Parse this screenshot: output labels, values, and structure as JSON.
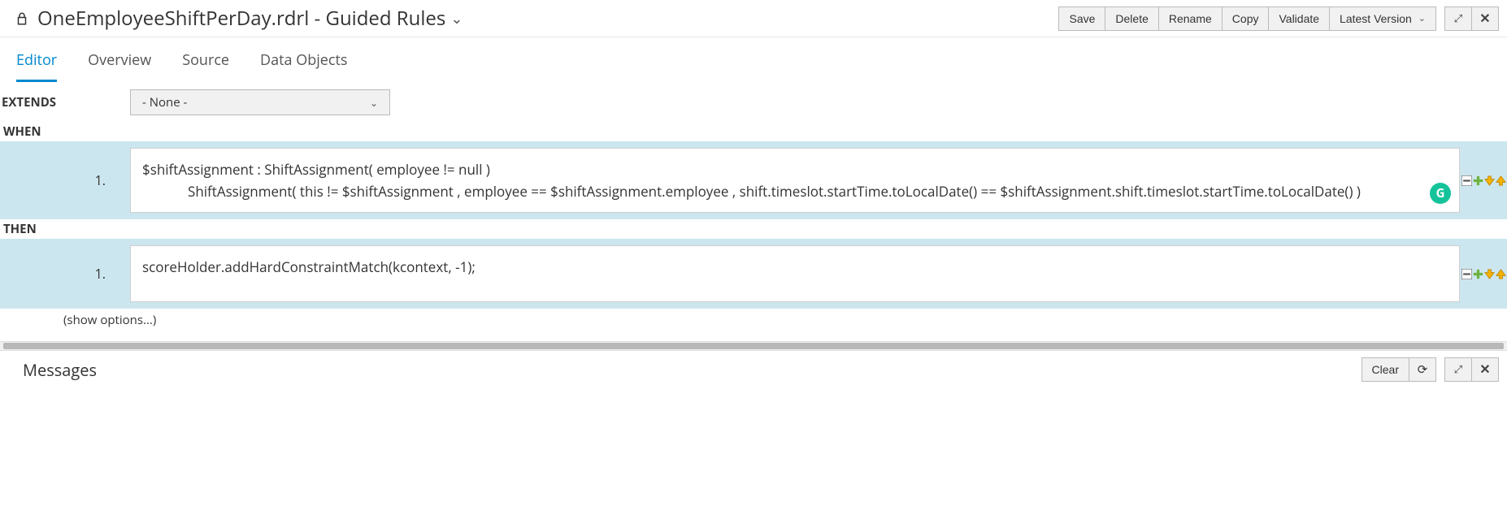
{
  "header": {
    "title": "OneEmployeeShiftPerDay.rdrl - Guided Rules"
  },
  "toolbar": {
    "save": "Save",
    "delete": "Delete",
    "rename": "Rename",
    "copy": "Copy",
    "validate": "Validate",
    "version": "Latest Version"
  },
  "tabs": {
    "editor": "Editor",
    "overview": "Overview",
    "source": "Source",
    "dataObjects": "Data Objects"
  },
  "extends": {
    "label": "EXTENDS",
    "value": "- None -"
  },
  "when": {
    "label": "WHEN",
    "items": [
      {
        "num": "1.",
        "line1": "$shiftAssignment : ShiftAssignment( employee != null )",
        "line2": "ShiftAssignment( this != $shiftAssignment , employee == $shiftAssignment.employee , shift.timeslot.startTime.toLocalDate() == $shiftAssignment.shift.timeslot.startTime.toLocalDate() )"
      }
    ]
  },
  "then": {
    "label": "THEN",
    "items": [
      {
        "num": "1.",
        "text": "scoreHolder.addHardConstraintMatch(kcontext, -1);"
      }
    ]
  },
  "showOptions": "(show options...)",
  "messages": {
    "title": "Messages",
    "clear": "Clear"
  }
}
